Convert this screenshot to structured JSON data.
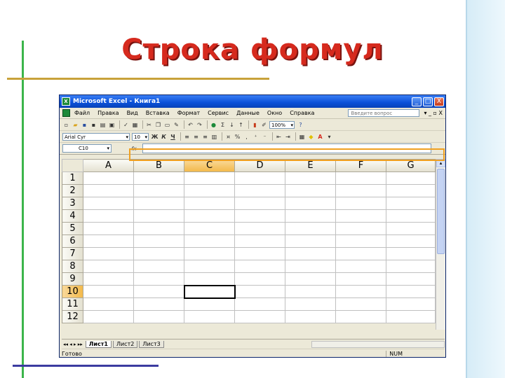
{
  "slide": {
    "title": "Строка формул"
  },
  "window": {
    "title": "Microsoft Excel - Книга1",
    "app_icon_glyph": "X",
    "minimize_glyph": "_",
    "maximize_glyph": "□",
    "close_glyph": "X"
  },
  "menu": {
    "items": [
      "Файл",
      "Правка",
      "Вид",
      "Вставка",
      "Формат",
      "Сервис",
      "Данные",
      "Окно",
      "Справка"
    ],
    "help_placeholder": "Введите вопрос",
    "right_glyphs": "▾ _ ▫ X"
  },
  "toolbar": {
    "zoom": "100%",
    "font_name": "Arial Cyr",
    "font_size": "10",
    "bold": "Ж",
    "italic": "К",
    "underline": "Ч",
    "sigma": "Σ",
    "percent": "%",
    "font_color_letter": "A"
  },
  "formula_bar": {
    "cell_ref": "C10",
    "fx": "fx",
    "value": ""
  },
  "sheet": {
    "columns": [
      "A",
      "B",
      "C",
      "D",
      "E",
      "F",
      "G"
    ],
    "rows": [
      "1",
      "2",
      "3",
      "4",
      "5",
      "6",
      "7",
      "8",
      "9",
      "10",
      "11",
      "12"
    ],
    "selected_column": "C",
    "selected_row": "10"
  },
  "tabs": {
    "nav": "◂◂ ◂ ▸ ▸▸",
    "items": [
      "Лист1",
      "Лист2",
      "Лист3"
    ]
  },
  "status": {
    "left": "Готово",
    "right": "NUM"
  },
  "colors": {
    "title_red": "#d62a1e",
    "highlight_orange": "#f0a020",
    "selected_header": "#f3b949"
  }
}
